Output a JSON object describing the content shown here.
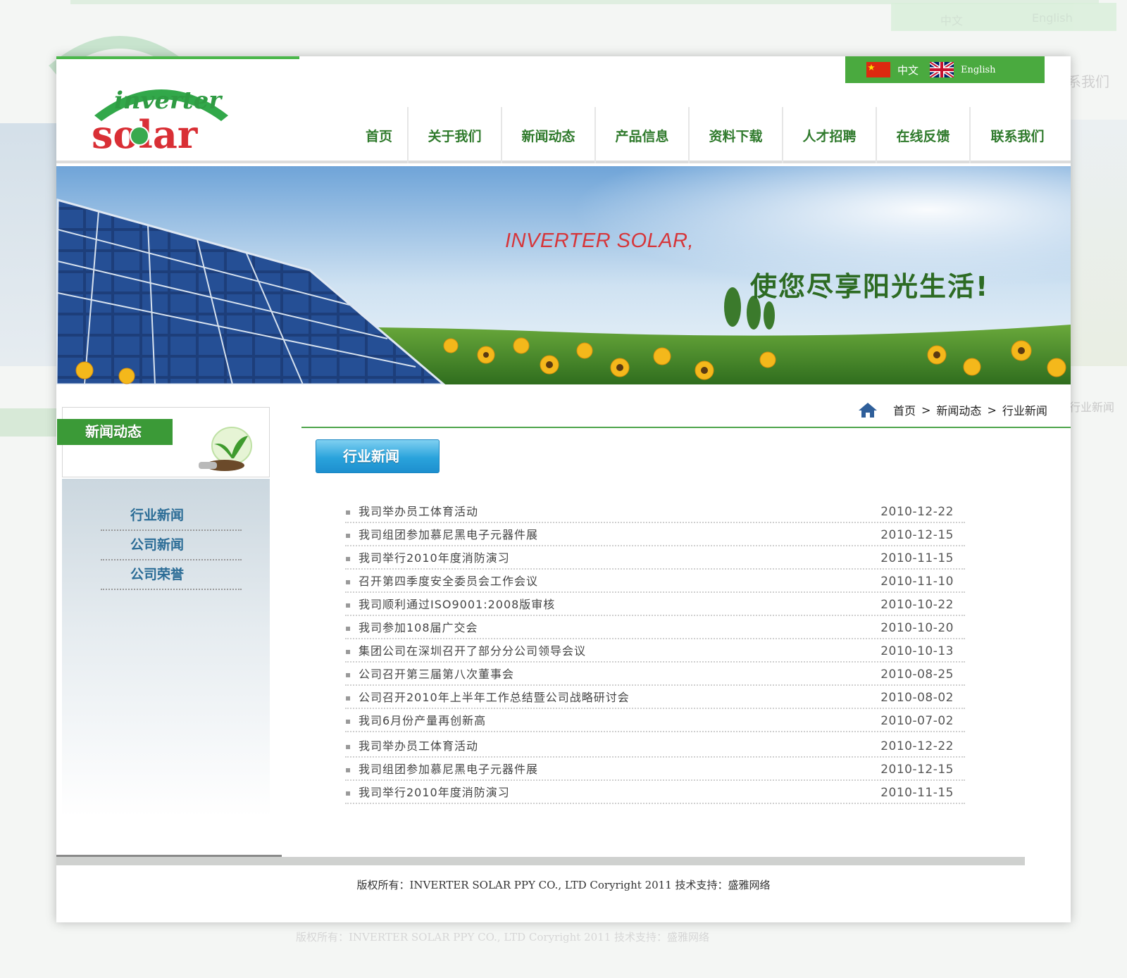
{
  "language_switch": {
    "zh_label": "中文",
    "en_label": "English"
  },
  "logo": {
    "line1": "inverter",
    "line2": "solar"
  },
  "nav": [
    {
      "label": "首页"
    },
    {
      "label": "关于我们"
    },
    {
      "label": "新闻动态"
    },
    {
      "label": "产品信息"
    },
    {
      "label": "资料下载"
    },
    {
      "label": "人才招聘"
    },
    {
      "label": "在线反馈"
    },
    {
      "label": "联系我们"
    }
  ],
  "banner": {
    "headline": "INVERTER SOLAR,",
    "slogan": "使您尽享阳光生活!"
  },
  "sidebar": {
    "title": "新闻动态",
    "items": [
      {
        "label": "行业新闻"
      },
      {
        "label": "公司新闻"
      },
      {
        "label": "公司荣誉"
      }
    ]
  },
  "breadcrumb": {
    "home": "首页",
    "level1": "新闻动态",
    "current": "行业新闻",
    "separator": ">"
  },
  "section_title": "行业新闻",
  "news": [
    {
      "title": "我司举办员工体育活动",
      "date": "2010-12-22"
    },
    {
      "title": "我司组团参加慕尼黑电子元器件展",
      "date": "2010-12-15"
    },
    {
      "title": "我司举行2010年度消防演习",
      "date": "2010-11-15"
    },
    {
      "title": "召开第四季度安全委员会工作会议",
      "date": "2010-11-10"
    },
    {
      "title": "我司顺利通过ISO9001:2008版审核",
      "date": "2010-10-22"
    },
    {
      "title": "我司参加108届广交会",
      "date": "2010-10-20"
    },
    {
      "title": "集团公司在深圳召开了部分分公司领导会议",
      "date": "2010-10-13"
    },
    {
      "title": "公司召开第三届第八次董事会",
      "date": "2010-08-25"
    },
    {
      "title": "公司召开2010年上半年工作总结暨公司战略研讨会",
      "date": "2010-08-02"
    },
    {
      "title": "我司6月份产量再创新高",
      "date": "2010-07-02"
    },
    {
      "title": "我司举办员工体育活动",
      "date": "2010-12-22"
    },
    {
      "title": "我司组团参加慕尼黑电子元器件展",
      "date": "2010-12-15"
    },
    {
      "title": "我司举行2010年度消防演习",
      "date": "2010-11-15"
    }
  ],
  "footer": {
    "text": "版权所有：INVERTER SOLAR PPY CO., LTD  Coryright 2011  技术支持：盛雅网络"
  },
  "colors": {
    "brand_green": "#3b9a37",
    "nav_green": "#2f7a2c",
    "headline_red": "#d6363a",
    "sidebar_blue": "#2b6c96",
    "section_blue": "#2aa3dc"
  },
  "icons": {
    "home": "home-icon",
    "cn_flag": "china-flag-icon",
    "uk_flag": "uk-flag-icon",
    "bulb": "lightbulb-plant-icon"
  }
}
